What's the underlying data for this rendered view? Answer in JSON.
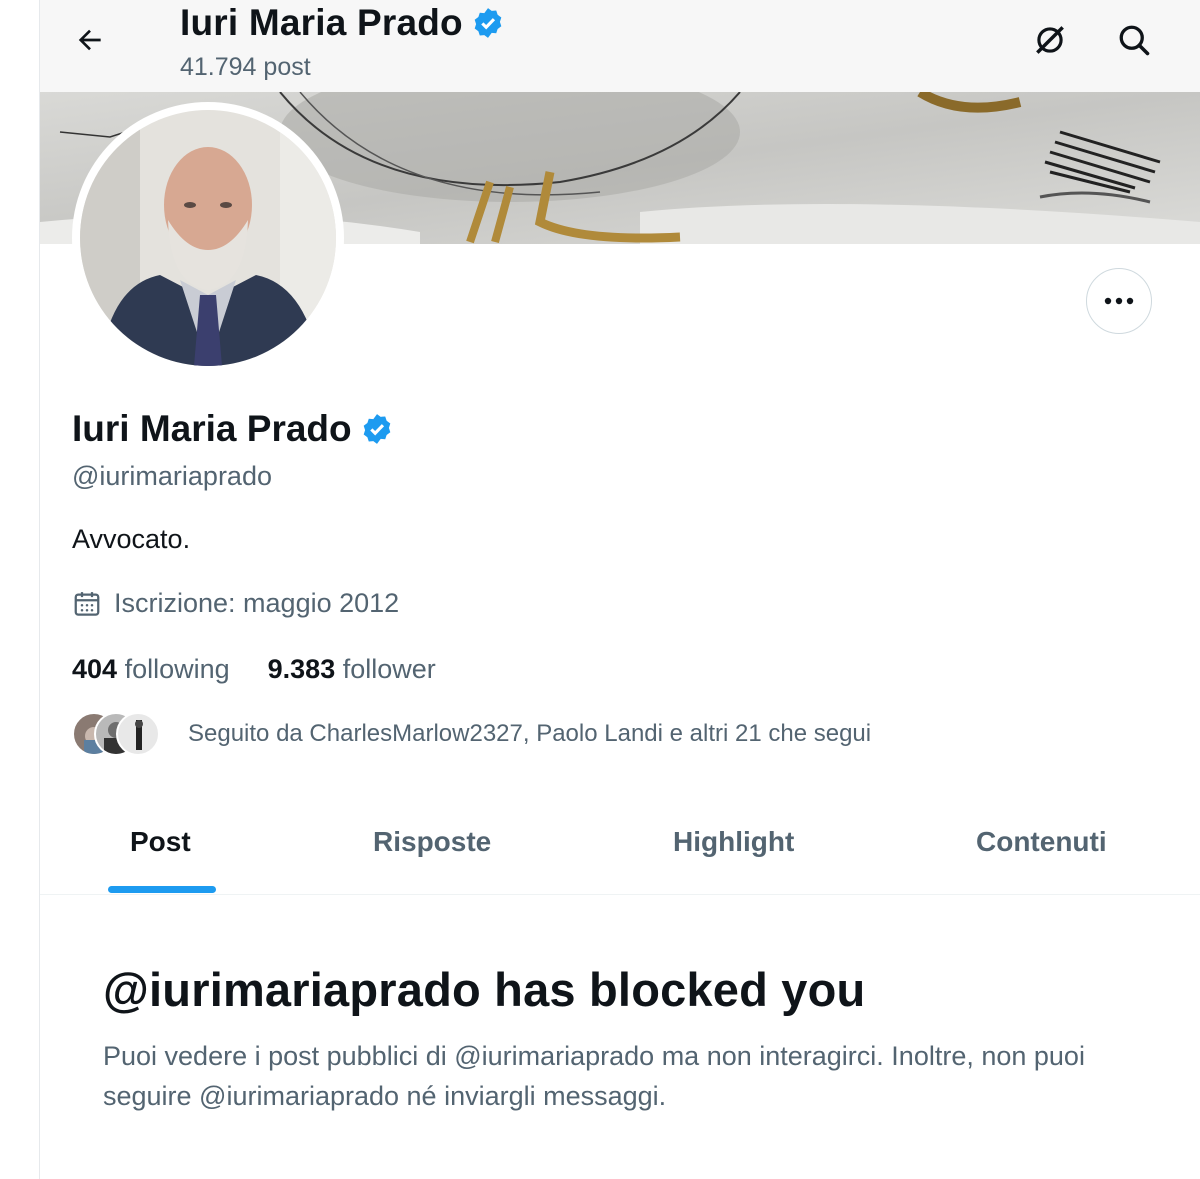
{
  "header": {
    "name": "Iuri Maria Prado",
    "post_count": "41.794 post",
    "icons": [
      "back-arrow-icon",
      "verified-badge-icon",
      "grok-icon",
      "search-icon"
    ]
  },
  "profile": {
    "name": "Iuri Maria Prado",
    "handle": "@iurimariaprado",
    "bio": "Avvocato.",
    "joined": "Iscrizione: maggio 2012",
    "following_count": "404",
    "following_label": "following",
    "followers_count": "9.383",
    "followers_label": "follower",
    "followed_by": "Seguito da CharlesMarlow2327, Paolo Landi e altri 21 che segui"
  },
  "tabs": [
    {
      "label": "Post",
      "active": true
    },
    {
      "label": "Risposte",
      "active": false
    },
    {
      "label": "Highlight",
      "active": false
    },
    {
      "label": "Contenuti",
      "active": false
    }
  ],
  "blocked": {
    "title": "@iurimariaprado has blocked you",
    "description": "Puoi vedere i post pubblici di @iurimariaprado ma non interagirci. Inoltre, non puoi seguire @iurimariaprado né inviargli messaggi."
  },
  "colors": {
    "accent": "#1d9bf0",
    "text": "#0f1419",
    "secondary": "#536471",
    "verified": "#1d9bf0"
  }
}
